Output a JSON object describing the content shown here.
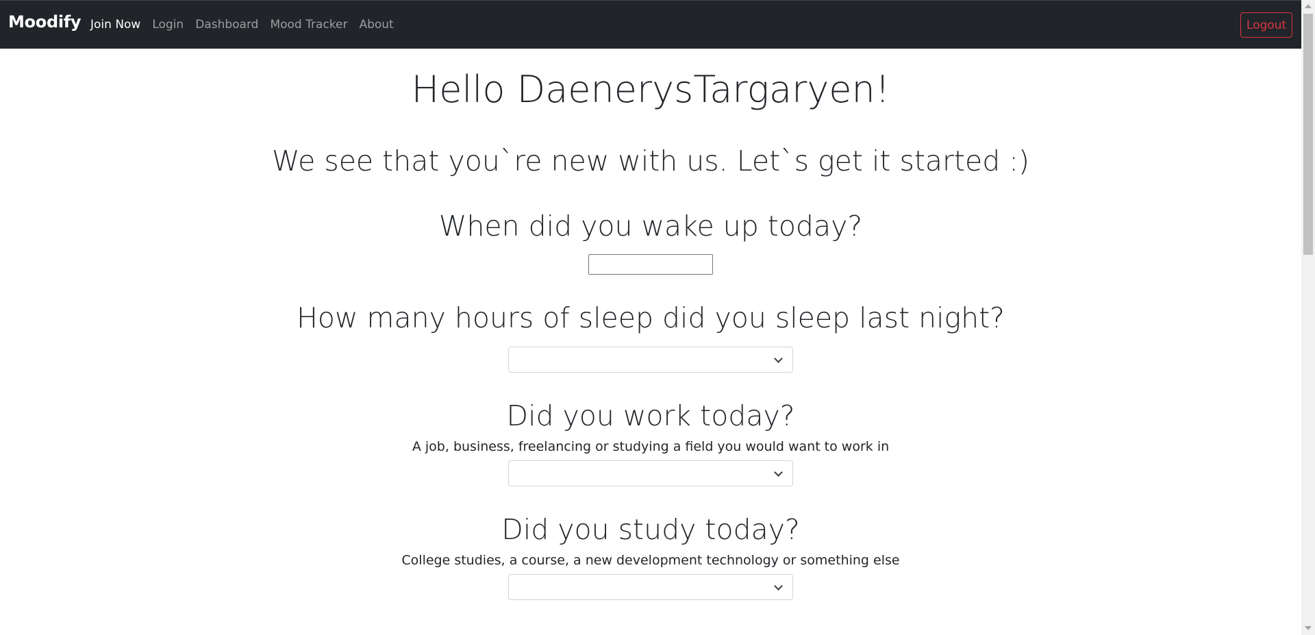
{
  "navbar": {
    "brand": "Moodify",
    "links": [
      "Join Now",
      "Login",
      "Dashboard",
      "Mood Tracker",
      "About"
    ],
    "logout_label": "Logout"
  },
  "main": {
    "greeting": "Hello DaenerysTargaryen!",
    "intro": "We see that you`re new with us. Let`s get it started :)",
    "questions": [
      {
        "title": "When did you wake up today?",
        "value": ""
      },
      {
        "title": "How many hours of sleep did you sleep last night?",
        "value": ""
      },
      {
        "title": "Did you work today?",
        "subtitle": "A job, business, freelancing or studying a field you would want to work in",
        "value": ""
      },
      {
        "title": "Did you study today?",
        "subtitle": "College studies, a course, a new development technology or something else",
        "value": ""
      }
    ]
  },
  "colors": {
    "navbar_bg": "#212529",
    "logout_accent": "#dc3545"
  }
}
